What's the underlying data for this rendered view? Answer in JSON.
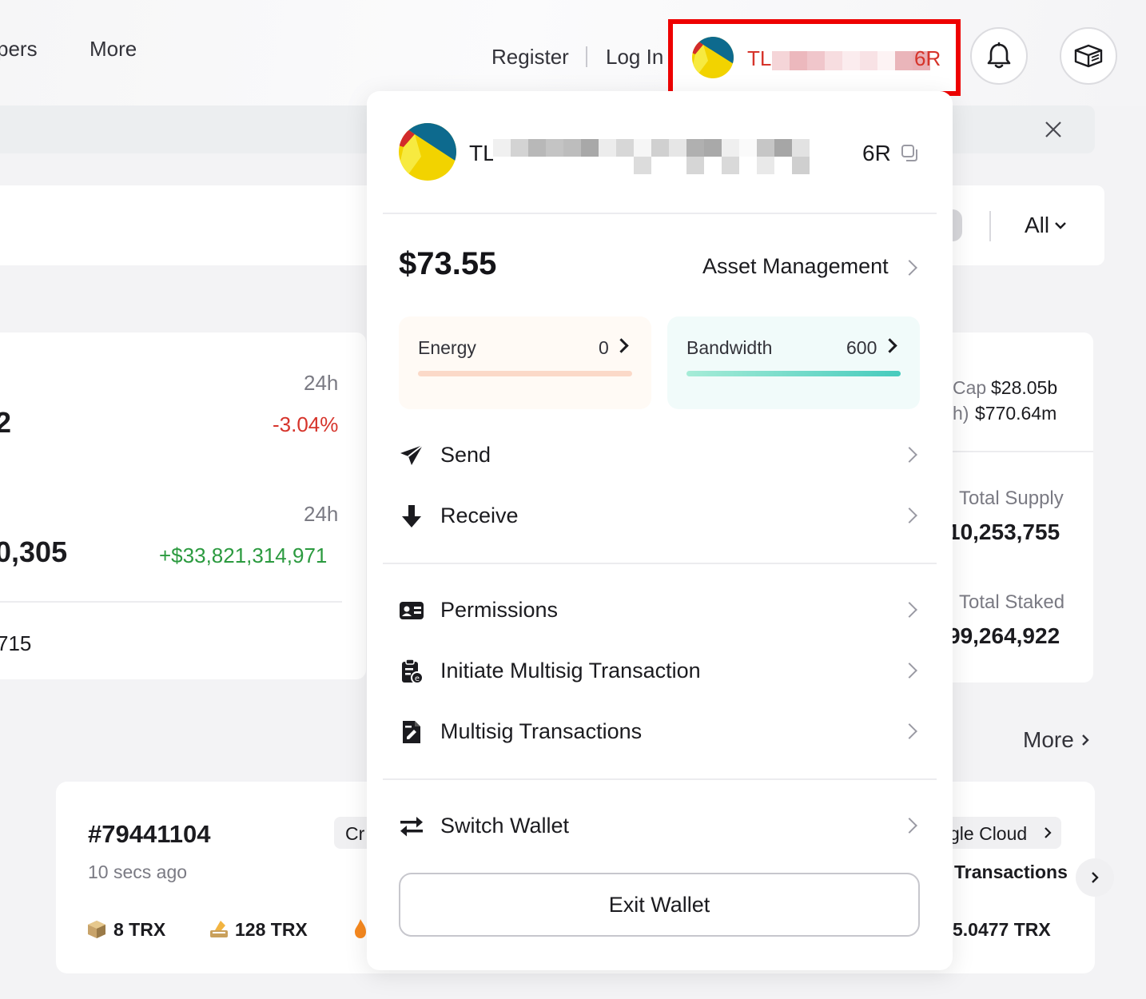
{
  "nav": {
    "developers_partial": "pers",
    "more": "More",
    "register": "Register",
    "login": "Log In",
    "wallet_addr_start": "TL",
    "wallet_addr_end": "6R"
  },
  "filter": {
    "all": "All"
  },
  "left_card": {
    "period_1": "24h",
    "value_1_partial": "2",
    "change_1": "-3.04%",
    "period_2": "24h",
    "value_2_partial": "0,305",
    "change_2": "+$33,821,314,971",
    "value_3_partial": "715"
  },
  "right_card": {
    "cap_label_partial": "Cap",
    "cap_value": "$28.05b",
    "vol_label_partial": "h)",
    "vol_value": "$770.64m",
    "total_supply_label": "Total Supply",
    "total_supply_partial": "10,253,755",
    "total_staked_label": "Total Staked",
    "total_staked_partial": "99,264,922"
  },
  "blocks": {
    "more": "More",
    "block_number": "#79441104",
    "time_ago": "10 secs ago",
    "reward_1": "8 TRX",
    "reward_2": "128 TRX",
    "chip_partial": "Cr",
    "producer_partial": "gle Cloud",
    "transactions_partial": "Transactions",
    "trx_value_partial": "5.0477 TRX"
  },
  "wallet_menu": {
    "addr_start": "TL",
    "addr_end": "6R",
    "balance": "$73.55",
    "asset_management": "Asset Management",
    "energy": {
      "label": "Energy",
      "value": "0"
    },
    "bandwidth": {
      "label": "Bandwidth",
      "value": "600"
    },
    "items": [
      {
        "label": "Send",
        "icon": "send-icon"
      },
      {
        "label": "Receive",
        "icon": "receive-icon"
      },
      {
        "label": "Permissions",
        "icon": "permissions-icon"
      },
      {
        "label": "Initiate Multisig Transaction",
        "icon": "initiate-multisig-icon"
      },
      {
        "label": "Multisig Transactions",
        "icon": "multisig-transactions-icon"
      },
      {
        "label": "Switch Wallet",
        "icon": "switch-wallet-icon"
      }
    ],
    "exit_wallet": "Exit Wallet"
  },
  "colors": {
    "accent_red": "#d6342b",
    "highlight_box": "#ee0000",
    "positive_green": "#2b9a3f",
    "energy_bar": "#fbd9c8",
    "bandwidth_bar_from": "#a6ecd7",
    "bandwidth_bar_to": "#46cbbd"
  }
}
